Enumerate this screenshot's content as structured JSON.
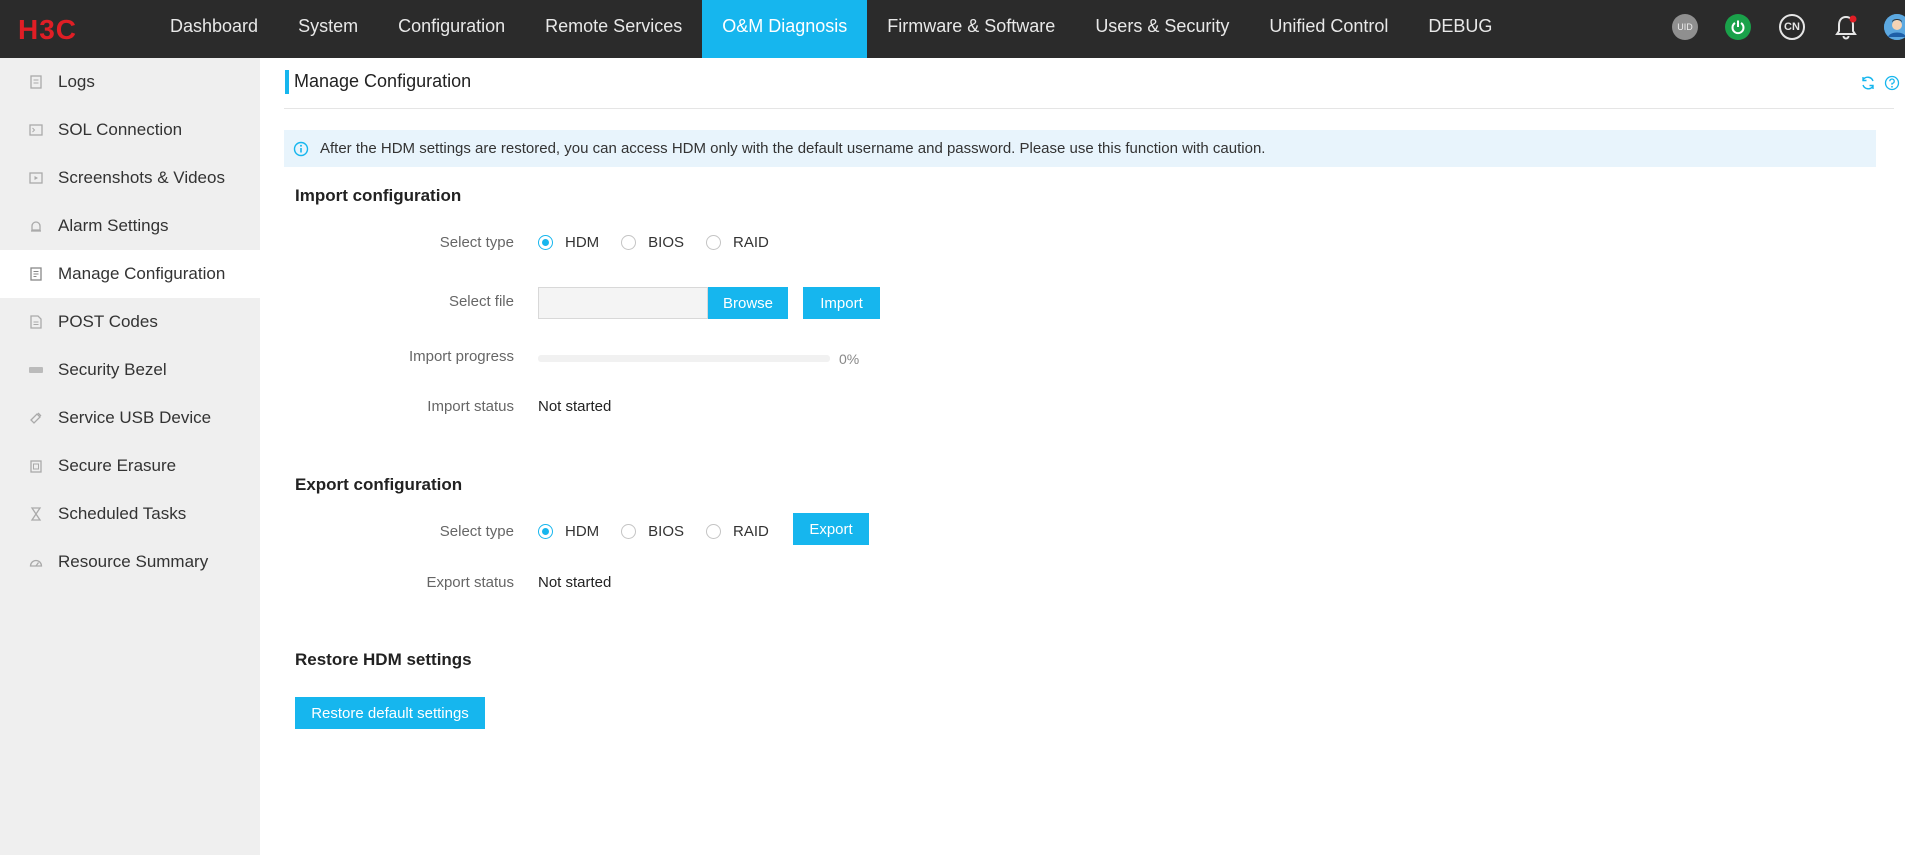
{
  "header": {
    "logo_text": "H3C",
    "nav": [
      {
        "label": "Dashboard"
      },
      {
        "label": "System"
      },
      {
        "label": "Configuration"
      },
      {
        "label": "Remote Services"
      },
      {
        "label": "O&M Diagnosis"
      },
      {
        "label": "Firmware & Software"
      },
      {
        "label": "Users & Security"
      },
      {
        "label": "Unified Control"
      },
      {
        "label": "DEBUG"
      }
    ],
    "active_nav": "O&M Diagnosis",
    "icons": {
      "uid": "UID",
      "lang": "CN",
      "power": "power-icon",
      "bell": "bell-icon",
      "user": "user-avatar-icon"
    }
  },
  "sidebar": {
    "items": [
      {
        "label": "Logs",
        "icon": "document-icon"
      },
      {
        "label": "SOL Connection",
        "icon": "terminal-icon"
      },
      {
        "label": "Screenshots & Videos",
        "icon": "video-icon"
      },
      {
        "label": "Alarm Settings",
        "icon": "alarm-icon"
      },
      {
        "label": "Manage Configuration",
        "icon": "config-file-icon"
      },
      {
        "label": "POST Codes",
        "icon": "code-file-icon"
      },
      {
        "label": "Security Bezel",
        "icon": "bezel-icon"
      },
      {
        "label": "Service USB Device",
        "icon": "usb-icon"
      },
      {
        "label": "Secure Erasure",
        "icon": "erase-icon"
      },
      {
        "label": "Scheduled Tasks",
        "icon": "hourglass-icon"
      },
      {
        "label": "Resource Summary",
        "icon": "gauge-icon"
      }
    ],
    "active": "Manage Configuration"
  },
  "page": {
    "title": "Manage Configuration",
    "notice": "After the HDM settings are restored, you can access HDM only with the default username and password. Please use this function with caution.",
    "import": {
      "title": "Import configuration",
      "select_type_label": "Select type",
      "types": [
        "HDM",
        "BIOS",
        "RAID"
      ],
      "selected_type": "HDM",
      "select_file_label": "Select file",
      "file_value": "",
      "browse_label": "Browse",
      "import_label": "Import",
      "progress_label": "Import progress",
      "progress_value": 0,
      "progress_text": "0%",
      "status_label": "Import status",
      "status_value": "Not started"
    },
    "export": {
      "title": "Export configuration",
      "select_type_label": "Select type",
      "types": [
        "HDM",
        "BIOS",
        "RAID"
      ],
      "selected_type": "HDM",
      "export_label": "Export",
      "status_label": "Export status",
      "status_value": "Not started"
    },
    "restore": {
      "title": "Restore HDM settings",
      "button_label": "Restore default settings"
    }
  },
  "colors": {
    "accent": "#16b6ee",
    "topbar": "#2b2b2b",
    "sidebar": "#efefef",
    "notice_bg": "#e8f4fc",
    "power": "#1aa14a"
  }
}
